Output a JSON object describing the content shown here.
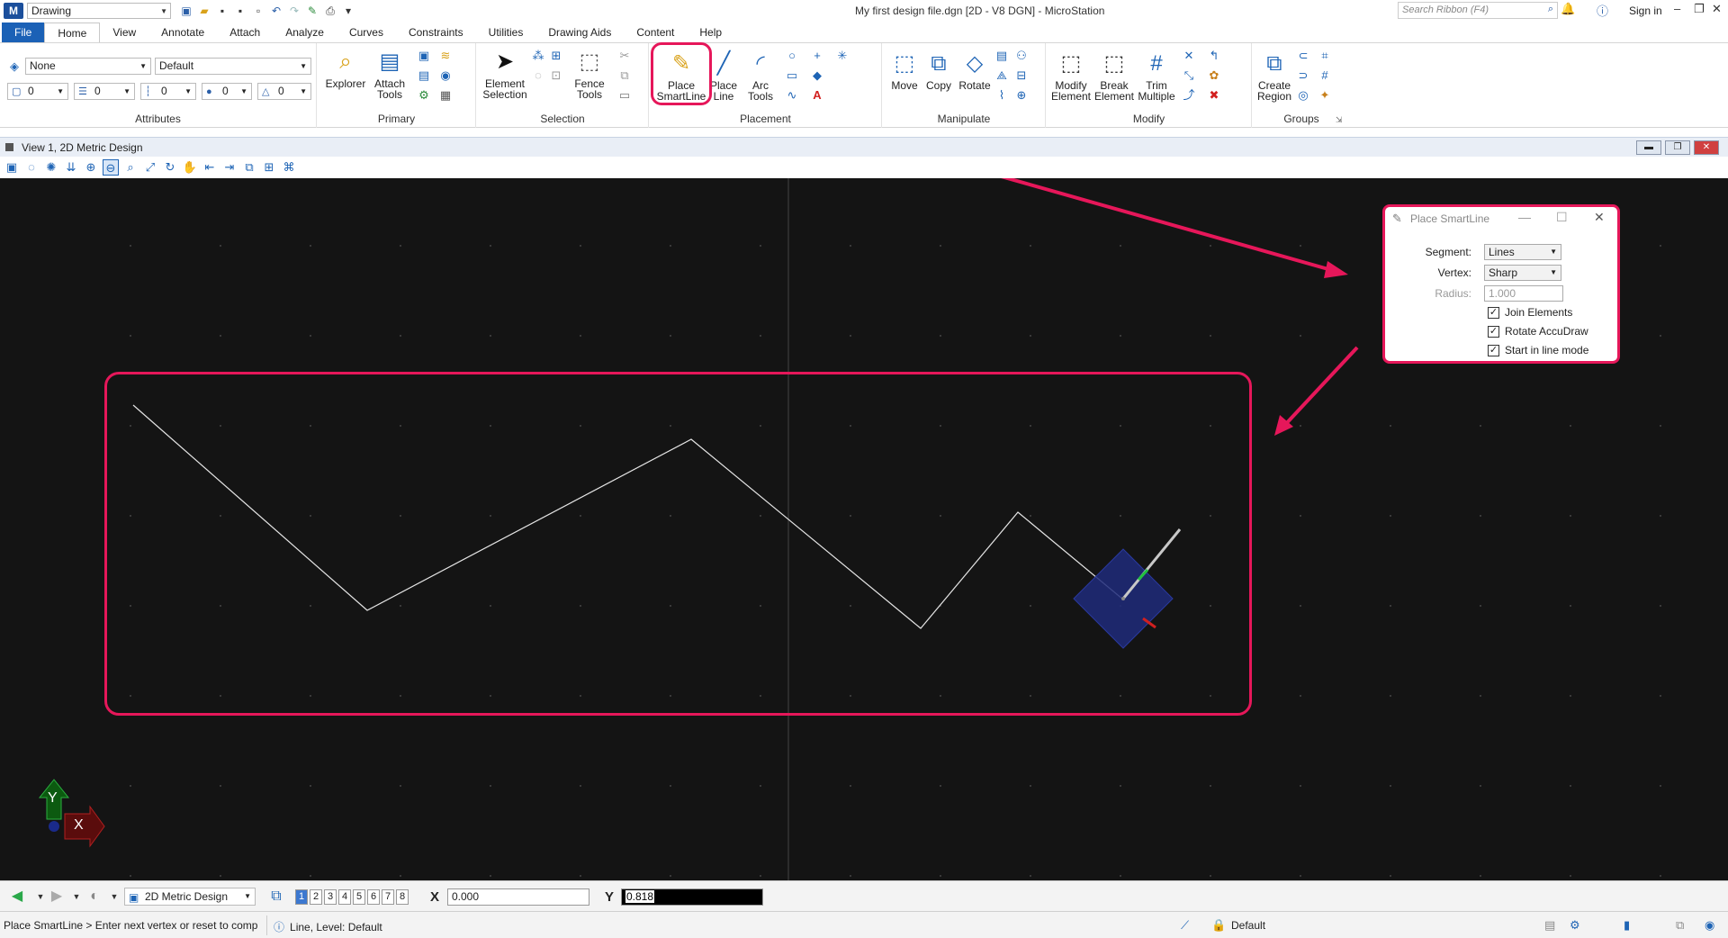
{
  "titlebar": {
    "workspace": "Drawing",
    "title": "My first design file.dgn [2D - V8 DGN] - MicroStation",
    "search_placeholder": "Search Ribbon (F4)",
    "sign_in": "Sign in"
  },
  "tabs": [
    {
      "label": "File"
    },
    {
      "label": "Home"
    },
    {
      "label": "View"
    },
    {
      "label": "Annotate"
    },
    {
      "label": "Attach"
    },
    {
      "label": "Analyze"
    },
    {
      "label": "Curves"
    },
    {
      "label": "Constraints"
    },
    {
      "label": "Utilities"
    },
    {
      "label": "Drawing Aids"
    },
    {
      "label": "Content"
    },
    {
      "label": "Help"
    }
  ],
  "ribbon": {
    "attributes": {
      "label": "Attributes",
      "level": "None",
      "text_style": "Default",
      "color": "0",
      "weight": "0",
      "style": "0",
      "transparency": "0",
      "priority": "0"
    },
    "primary": {
      "label": "Primary",
      "explorer": "Explorer",
      "attach_tools": "Attach Tools"
    },
    "selection": {
      "label": "Selection",
      "element_selection": "Element Selection",
      "fence_tools": "Fence Tools"
    },
    "placement": {
      "label": "Placement",
      "place_smartline": "Place SmartLine",
      "place_line": "Place Line",
      "arc_tools": "Arc Tools"
    },
    "manipulate": {
      "label": "Manipulate",
      "move": "Move",
      "copy": "Copy",
      "rotate": "Rotate"
    },
    "modify": {
      "label": "Modify",
      "modify_element": "Modify Element",
      "break_element": "Break Element",
      "trim_multiple": "Trim Multiple"
    },
    "groups": {
      "label": "Groups",
      "create_region": "Create Region"
    }
  },
  "view": {
    "title": "View 1, 2D Metric Design"
  },
  "dialog": {
    "title": "Place SmartLine",
    "segment_label": "Segment:",
    "segment_value": "Lines",
    "vertex_label": "Vertex:",
    "vertex_value": "Sharp",
    "radius_label": "Radius:",
    "radius_value": "1.000",
    "options": [
      {
        "label": "Join Elements",
        "checked": true
      },
      {
        "label": "Rotate AccuDraw",
        "checked": true
      },
      {
        "label": "Start in line mode",
        "checked": true
      }
    ]
  },
  "canvas": {
    "axis_y": "Y",
    "axis_x": "X"
  },
  "statusbar": {
    "model": "2D Metric Design",
    "views": [
      "1",
      "2",
      "3",
      "4",
      "5",
      "6",
      "7",
      "8"
    ],
    "x_label": "X",
    "x_value": "0.000",
    "y_label": "Y",
    "y_value": "0.818",
    "prompt": "Place SmartLine > Enter next vertex or reset to comp",
    "message": "Line, Level: Default",
    "active_level": "Default"
  },
  "colors": {
    "accent": "#e6175a",
    "canvas_bg": "#141414",
    "file_tab": "#1b61b6"
  }
}
